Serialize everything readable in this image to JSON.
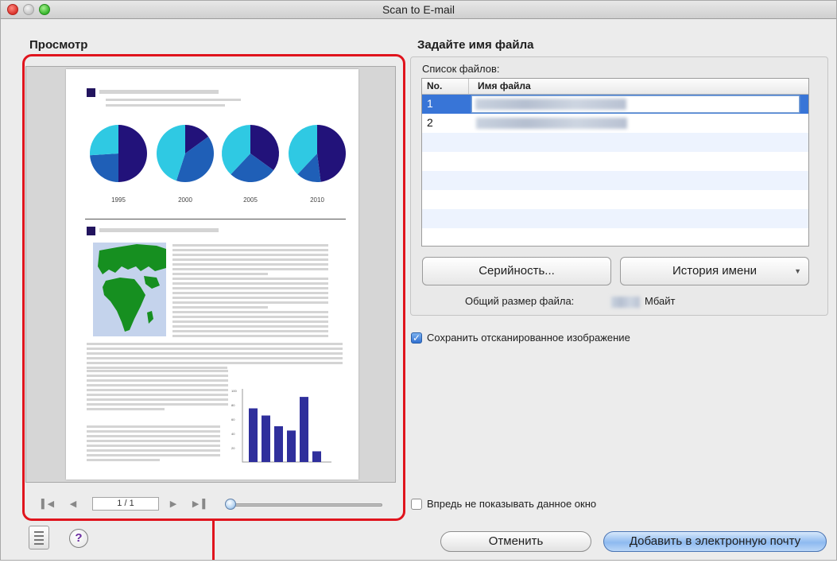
{
  "window": {
    "title": "Scan to E-mail"
  },
  "preview": {
    "section_title": "Просмотр",
    "page_indicator": "1 / 1",
    "zoom_percent": 0,
    "document": {
      "pie_years": [
        "1995",
        "2000",
        "2005",
        "2010"
      ],
      "bar_axis_ticks": [
        "100",
        "80",
        "60",
        "40",
        "20"
      ],
      "bar_values": [
        75,
        65,
        50,
        44,
        91,
        15
      ]
    }
  },
  "filename": {
    "section_title": "Задайте имя файла",
    "list_label": "Список файлов:",
    "columns": {
      "no": "No.",
      "name": "Имя файла"
    },
    "rows": [
      {
        "no": "1"
      },
      {
        "no": "2"
      }
    ],
    "serial_button": "Серийность...",
    "history_button": "История имени",
    "size_label": "Общий размер файла:",
    "size_unit": "Мбайт"
  },
  "options": {
    "save_image_label": "Сохранить отсканированное изображение",
    "save_image_checked": true,
    "dont_show_label": "Впредь не показывать данное окно",
    "dont_show_checked": false
  },
  "actions": {
    "cancel": "Отменить",
    "add_to_email": "Добавить в электронную почту"
  },
  "colors": {
    "highlight": "#e0141d",
    "selection": "#3875d7",
    "pie_dark": "#22127a",
    "pie_light": "#2fc9e3",
    "pie_mid": "#1f5fb7",
    "bars": "#2f2f9c",
    "map_green": "#168f20"
  }
}
